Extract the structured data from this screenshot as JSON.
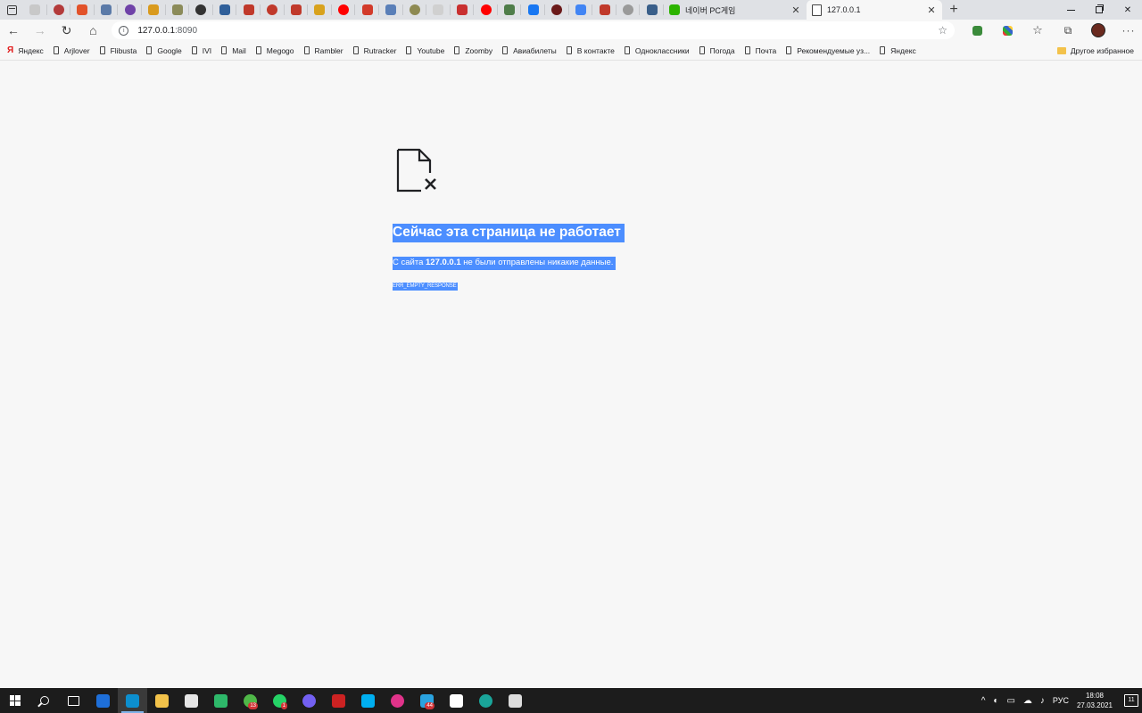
{
  "tabs": {
    "pinned": [
      {
        "icon": "blank-page-icon",
        "color": "#c8c8c8"
      },
      {
        "icon": "red-mark-icon",
        "color": "#b33a3a"
      },
      {
        "icon": "orange-logo-icon",
        "color": "#e2522a"
      },
      {
        "icon": "chat-icon",
        "color": "#5b7aa8"
      },
      {
        "icon": "purple-logo-icon",
        "color": "#6f42a8"
      },
      {
        "icon": "mail-icon",
        "color": "#d99a1e"
      },
      {
        "icon": "grey-logo-icon",
        "color": "#8b8b5a"
      },
      {
        "icon": "dark-logo-icon",
        "color": "#333333"
      },
      {
        "icon": "blue-dot-icon",
        "color": "#2f5f9a"
      },
      {
        "icon": "red-logo-icon",
        "color": "#c0392b"
      },
      {
        "icon": "red-logo-icon",
        "color": "#c0392b"
      },
      {
        "icon": "red-logo-icon",
        "color": "#c0392b"
      },
      {
        "icon": "yellow-ring-icon",
        "color": "#d8a21d"
      },
      {
        "icon": "youtube-icon",
        "color": "#ff0000"
      },
      {
        "icon": "red-triangle-icon",
        "color": "#d23a2a"
      },
      {
        "icon": "translate-icon",
        "color": "#5a7fb8"
      },
      {
        "icon": "olive-logo-icon",
        "color": "#8e8a52"
      },
      {
        "icon": "blank-page-icon",
        "color": "#d0d0d0"
      },
      {
        "icon": "red-mark-icon",
        "color": "#c93030"
      },
      {
        "icon": "youtube-icon",
        "color": "#ff0000"
      },
      {
        "icon": "green-logo-icon",
        "color": "#4f7d4a"
      },
      {
        "icon": "facebook-icon",
        "color": "#1877f2"
      },
      {
        "icon": "dark-red-logo-icon",
        "color": "#6b1a1a"
      },
      {
        "icon": "google-icon",
        "color": "#4285f4"
      },
      {
        "icon": "red-mark-icon",
        "color": "#c0392b"
      },
      {
        "icon": "grey-logo-icon",
        "color": "#9a9a9a"
      },
      {
        "icon": "blue-wave-icon",
        "color": "#3a5f8a"
      }
    ],
    "naver": {
      "title": "네이버 PC게임",
      "icon_color": "#2db400"
    },
    "active": {
      "title": "127.0.0.1"
    },
    "close_glyph": "✕",
    "new_tab_glyph": "+"
  },
  "toolbar": {
    "url_host": "127.0.0.1",
    "url_port": ":8090",
    "back_glyph": "←",
    "forward_glyph": "→",
    "reload_glyph": "↻",
    "home_glyph": "⌂",
    "info_glyph": "i",
    "add_fav_glyph": "☆",
    "favorites_glyph": "☆",
    "collections_glyph": "⧉",
    "more_glyph": "···"
  },
  "bookmarks": {
    "items": [
      {
        "label": "Яндекс",
        "icon": "yandex-icon"
      },
      {
        "label": "Arjlover",
        "icon": "page-icon"
      },
      {
        "label": "Flibusta",
        "icon": "page-icon"
      },
      {
        "label": "Google",
        "icon": "page-icon"
      },
      {
        "label": "IVI",
        "icon": "page-icon"
      },
      {
        "label": "Mail",
        "icon": "page-icon"
      },
      {
        "label": "Megogo",
        "icon": "page-icon"
      },
      {
        "label": "Rambler",
        "icon": "page-icon"
      },
      {
        "label": "Rutracker",
        "icon": "page-icon"
      },
      {
        "label": "Youtube",
        "icon": "page-icon"
      },
      {
        "label": "Zoomby",
        "icon": "page-icon"
      },
      {
        "label": "Авиабилеты",
        "icon": "page-icon"
      },
      {
        "label": "В контакте",
        "icon": "page-icon"
      },
      {
        "label": "Одноклассники",
        "icon": "page-icon"
      },
      {
        "label": "Погода",
        "icon": "page-icon"
      },
      {
        "label": "Почта",
        "icon": "page-icon"
      },
      {
        "label": "Рекомендуемые уз...",
        "icon": "page-icon"
      },
      {
        "label": "Яндекс",
        "icon": "page-icon"
      }
    ],
    "other": "Другое избранное",
    "yandex_glyph": "Я"
  },
  "error": {
    "title": "Сейчас эта страница не работает",
    "desc_prefix": "С сайта ",
    "desc_host": "127.0.0.1",
    "desc_suffix": " не были отправлены никакие данные.",
    "code": "ERR_EMPTY_RESPONSE"
  },
  "taskbar": {
    "apps": [
      {
        "name": "mail-app-icon",
        "color": "#1e6fd9",
        "active": false,
        "badge": ""
      },
      {
        "name": "edge-app-icon",
        "color": "#0c8fcf",
        "active": true,
        "badge": ""
      },
      {
        "name": "file-explorer-icon",
        "color": "#f2c24a",
        "active": false,
        "badge": ""
      },
      {
        "name": "store-app-icon",
        "color": "#e6e6e6",
        "active": false,
        "badge": ""
      },
      {
        "name": "search-app-icon",
        "color": "#2eb86a",
        "active": false,
        "badge": ""
      },
      {
        "name": "icq-app-icon",
        "color": "#4fb848",
        "active": false,
        "badge": "13"
      },
      {
        "name": "whatsapp-app-icon",
        "color": "#25d366",
        "active": false,
        "badge": "1"
      },
      {
        "name": "viber-app-icon",
        "color": "#7360f2",
        "active": false,
        "badge": ""
      },
      {
        "name": "game-app-icon",
        "color": "#cc2222",
        "active": false,
        "badge": ""
      },
      {
        "name": "skype-app-icon",
        "color": "#00aff0",
        "active": false,
        "badge": ""
      },
      {
        "name": "music-app-icon",
        "color": "#e0338a",
        "active": false,
        "badge": ""
      },
      {
        "name": "telegram-app-icon",
        "color": "#2aa3e0",
        "active": false,
        "badge": "44"
      },
      {
        "name": "vivaldi-app-icon",
        "color": "#ffffff",
        "active": false,
        "badge": ""
      },
      {
        "name": "e-app-icon",
        "color": "#1aa59a",
        "active": false,
        "badge": ""
      },
      {
        "name": "window-app-icon",
        "color": "#dcdcdc",
        "active": false,
        "badge": ""
      }
    ],
    "lang": "РУС",
    "time": "18:08",
    "date": "27.03.2021",
    "chevron_glyph": "^",
    "notif_count": "11"
  }
}
